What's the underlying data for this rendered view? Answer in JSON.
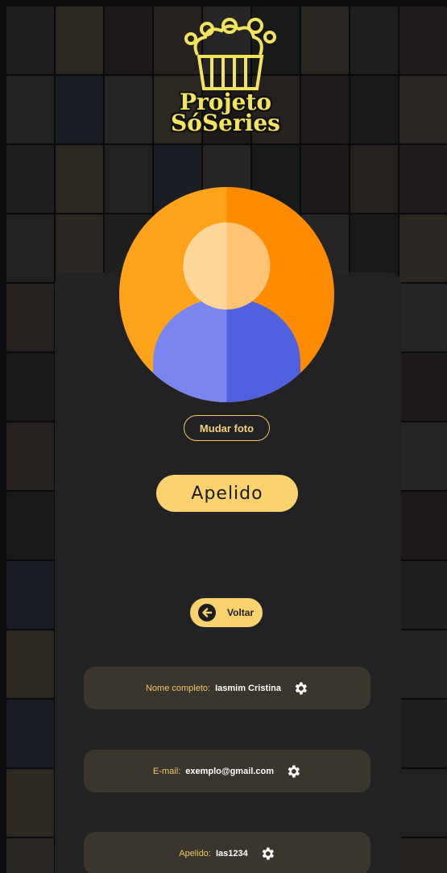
{
  "logo": {
    "line1": "Projeto",
    "line2": "SóSeries"
  },
  "profile": {
    "change_photo_label": "Mudar foto",
    "nickname": "Apelido",
    "back_label": "Voltar"
  },
  "fields": [
    {
      "label": "Nome completo:",
      "value": "Iasmim Cristina",
      "icon": "gear-icon"
    },
    {
      "label": "E-mail:",
      "value": "exemplo@gmail.com",
      "icon": "gear-icon"
    },
    {
      "label": "Apelido:",
      "value": "Ias1234",
      "icon": "gear-icon"
    }
  ],
  "colors": {
    "accent": "#fbd26e",
    "panel": "#222224",
    "card": "#3a362d",
    "label": "#f1c765",
    "avatar_orange": "#ff9f1c",
    "avatar_blue": "#5a69e6"
  }
}
